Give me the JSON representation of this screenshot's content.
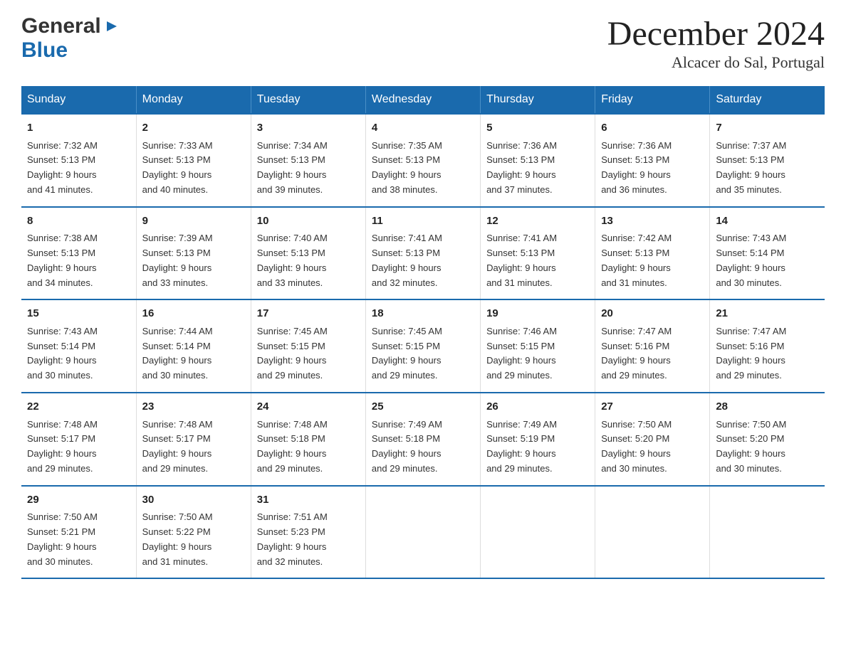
{
  "logo": {
    "general": "General",
    "blue": "Blue"
  },
  "title": "December 2024",
  "location": "Alcacer do Sal, Portugal",
  "weekdays": [
    "Sunday",
    "Monday",
    "Tuesday",
    "Wednesday",
    "Thursday",
    "Friday",
    "Saturday"
  ],
  "weeks": [
    [
      {
        "day": "1",
        "sunrise": "7:32 AM",
        "sunset": "5:13 PM",
        "daylight": "9 hours and 41 minutes."
      },
      {
        "day": "2",
        "sunrise": "7:33 AM",
        "sunset": "5:13 PM",
        "daylight": "9 hours and 40 minutes."
      },
      {
        "day": "3",
        "sunrise": "7:34 AM",
        "sunset": "5:13 PM",
        "daylight": "9 hours and 39 minutes."
      },
      {
        "day": "4",
        "sunrise": "7:35 AM",
        "sunset": "5:13 PM",
        "daylight": "9 hours and 38 minutes."
      },
      {
        "day": "5",
        "sunrise": "7:36 AM",
        "sunset": "5:13 PM",
        "daylight": "9 hours and 37 minutes."
      },
      {
        "day": "6",
        "sunrise": "7:36 AM",
        "sunset": "5:13 PM",
        "daylight": "9 hours and 36 minutes."
      },
      {
        "day": "7",
        "sunrise": "7:37 AM",
        "sunset": "5:13 PM",
        "daylight": "9 hours and 35 minutes."
      }
    ],
    [
      {
        "day": "8",
        "sunrise": "7:38 AM",
        "sunset": "5:13 PM",
        "daylight": "9 hours and 34 minutes."
      },
      {
        "day": "9",
        "sunrise": "7:39 AM",
        "sunset": "5:13 PM",
        "daylight": "9 hours and 33 minutes."
      },
      {
        "day": "10",
        "sunrise": "7:40 AM",
        "sunset": "5:13 PM",
        "daylight": "9 hours and 33 minutes."
      },
      {
        "day": "11",
        "sunrise": "7:41 AM",
        "sunset": "5:13 PM",
        "daylight": "9 hours and 32 minutes."
      },
      {
        "day": "12",
        "sunrise": "7:41 AM",
        "sunset": "5:13 PM",
        "daylight": "9 hours and 31 minutes."
      },
      {
        "day": "13",
        "sunrise": "7:42 AM",
        "sunset": "5:13 PM",
        "daylight": "9 hours and 31 minutes."
      },
      {
        "day": "14",
        "sunrise": "7:43 AM",
        "sunset": "5:14 PM",
        "daylight": "9 hours and 30 minutes."
      }
    ],
    [
      {
        "day": "15",
        "sunrise": "7:43 AM",
        "sunset": "5:14 PM",
        "daylight": "9 hours and 30 minutes."
      },
      {
        "day": "16",
        "sunrise": "7:44 AM",
        "sunset": "5:14 PM",
        "daylight": "9 hours and 30 minutes."
      },
      {
        "day": "17",
        "sunrise": "7:45 AM",
        "sunset": "5:15 PM",
        "daylight": "9 hours and 29 minutes."
      },
      {
        "day": "18",
        "sunrise": "7:45 AM",
        "sunset": "5:15 PM",
        "daylight": "9 hours and 29 minutes."
      },
      {
        "day": "19",
        "sunrise": "7:46 AM",
        "sunset": "5:15 PM",
        "daylight": "9 hours and 29 minutes."
      },
      {
        "day": "20",
        "sunrise": "7:47 AM",
        "sunset": "5:16 PM",
        "daylight": "9 hours and 29 minutes."
      },
      {
        "day": "21",
        "sunrise": "7:47 AM",
        "sunset": "5:16 PM",
        "daylight": "9 hours and 29 minutes."
      }
    ],
    [
      {
        "day": "22",
        "sunrise": "7:48 AM",
        "sunset": "5:17 PM",
        "daylight": "9 hours and 29 minutes."
      },
      {
        "day": "23",
        "sunrise": "7:48 AM",
        "sunset": "5:17 PM",
        "daylight": "9 hours and 29 minutes."
      },
      {
        "day": "24",
        "sunrise": "7:48 AM",
        "sunset": "5:18 PM",
        "daylight": "9 hours and 29 minutes."
      },
      {
        "day": "25",
        "sunrise": "7:49 AM",
        "sunset": "5:18 PM",
        "daylight": "9 hours and 29 minutes."
      },
      {
        "day": "26",
        "sunrise": "7:49 AM",
        "sunset": "5:19 PM",
        "daylight": "9 hours and 29 minutes."
      },
      {
        "day": "27",
        "sunrise": "7:50 AM",
        "sunset": "5:20 PM",
        "daylight": "9 hours and 30 minutes."
      },
      {
        "day": "28",
        "sunrise": "7:50 AM",
        "sunset": "5:20 PM",
        "daylight": "9 hours and 30 minutes."
      }
    ],
    [
      {
        "day": "29",
        "sunrise": "7:50 AM",
        "sunset": "5:21 PM",
        "daylight": "9 hours and 30 minutes."
      },
      {
        "day": "30",
        "sunrise": "7:50 AM",
        "sunset": "5:22 PM",
        "daylight": "9 hours and 31 minutes."
      },
      {
        "day": "31",
        "sunrise": "7:51 AM",
        "sunset": "5:23 PM",
        "daylight": "9 hours and 32 minutes."
      },
      null,
      null,
      null,
      null
    ]
  ],
  "labels": {
    "sunrise": "Sunrise:",
    "sunset": "Sunset:",
    "daylight": "Daylight:"
  }
}
